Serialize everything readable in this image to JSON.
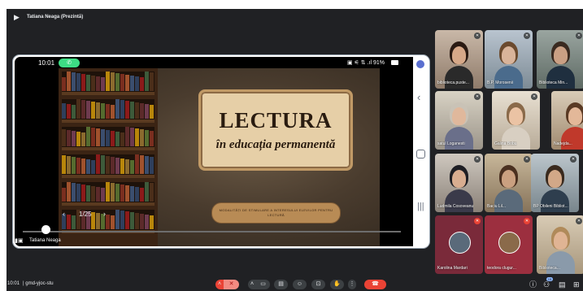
{
  "top_bar": {
    "title": "Tatiana Neaga (Prezintă)",
    "icon": "presentation-icon"
  },
  "phone": {
    "time": "10:01",
    "status_icons": "▣ ⚟ ⇅ .ıl",
    "battery": "91%",
    "nav_icons": [
      "circle-icon",
      "back-icon",
      "home-icon",
      "recent-apps-icon"
    ]
  },
  "slide": {
    "title": "LECTURA",
    "subtitle": "în educația permanentă",
    "banner": "MODALITĂȚI DE STIMULARE A INTERESULUI ELEVILOR PENTRU LECTURĂ",
    "counter": "1/25",
    "prev": "‹",
    "next": "›",
    "more_icon": "•••",
    "shrink_icon": "⤡"
  },
  "presenter": {
    "name": "Tatiana Neaga"
  },
  "participants": [
    {
      "name": "biblioteca.puste...",
      "muted": true
    },
    {
      "name": "B.P. Morosenii",
      "muted": true
    },
    {
      "name": "Biblioteca Min...",
      "muted": true
    },
    {
      "name": "satul Loganesti",
      "muted": true
    },
    {
      "name": "Galina Bobu",
      "muted": true
    },
    {
      "name": "Nadejda...",
      "muted": true
    },
    {
      "name": "Ludmila Cosoveanu",
      "muted": true
    },
    {
      "name": "Baciu Lil...",
      "muted": true
    },
    {
      "name": "BP Obileni Bibliot...",
      "muted": true
    },
    {
      "name": "Karolina Mardari",
      "muted": true
    },
    {
      "name": "teodora clugur...",
      "muted": true
    },
    {
      "name": "Biblioteca...",
      "muted": true
    }
  ],
  "bottom_bar": {
    "clock": "10:01",
    "separator": "|",
    "meeting_code": "gmd-yjoc-stu",
    "controls": {
      "mic": "✕",
      "camera": "▭",
      "captions": "▤",
      "emoji": "☺",
      "present": "⊡",
      "hand": "✋",
      "more": "⋮",
      "leave": "☎"
    },
    "participant_count": "15",
    "right_icons": {
      "info": "ⓘ",
      "people": "⚇",
      "chat": "▤",
      "activities": "⊞"
    }
  },
  "colors": {
    "meet_bg": "#202124",
    "leave_red": "#ea4335",
    "call_green": "#3ddc84",
    "title_card": "#e6cfa7"
  }
}
